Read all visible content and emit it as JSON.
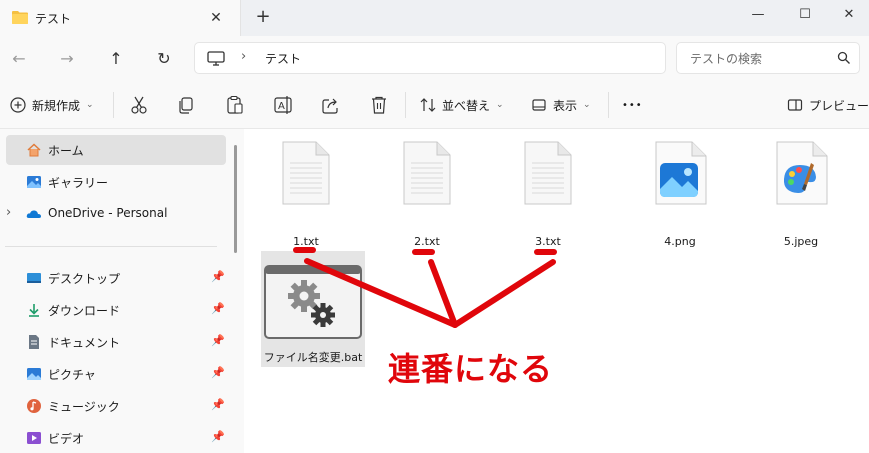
{
  "window": {
    "tab_title": "テスト",
    "close_tab_glyph": "✕",
    "new_tab_glyph": "+",
    "minimize_glyph": "—",
    "maximize_glyph": "☐",
    "close_glyph": "✕"
  },
  "address": {
    "back_glyph": "←",
    "forward_glyph": "→",
    "up_glyph": "↑",
    "refresh_glyph": "↻",
    "chevron": "›",
    "path": "テスト",
    "search_placeholder": "テストの検索"
  },
  "toolbar": {
    "new_label": "新規作成",
    "sort_label": "並べ替え",
    "view_label": "表示",
    "more_glyph": "•••",
    "preview_label": "プレビュー",
    "caret": "⌄"
  },
  "sidebar": {
    "items": [
      {
        "label": "ホーム",
        "icon": "home-icon"
      },
      {
        "label": "ギャラリー",
        "icon": "gallery-icon"
      },
      {
        "label": "OneDrive - Personal",
        "icon": "onedrive-icon"
      },
      {
        "label": "デスクトップ",
        "icon": "desktop-icon"
      },
      {
        "label": "ダウンロード",
        "icon": "download-icon"
      },
      {
        "label": "ドキュメント",
        "icon": "documents-icon"
      },
      {
        "label": "ピクチャ",
        "icon": "pictures-icon"
      },
      {
        "label": "ミュージック",
        "icon": "music-icon"
      },
      {
        "label": "ビデオ",
        "icon": "videos-icon"
      }
    ],
    "expand_glyph": "›",
    "pin_glyph": "📌"
  },
  "files": [
    {
      "name": "1.txt",
      "icon": "text-file-icon"
    },
    {
      "name": "2.txt",
      "icon": "text-file-icon"
    },
    {
      "name": "3.txt",
      "icon": "text-file-icon"
    },
    {
      "name": "4.png",
      "icon": "image-file-icon"
    },
    {
      "name": "5.jpeg",
      "icon": "paint-file-icon"
    },
    {
      "name": "ファイル名変更.bat",
      "icon": "batch-file-icon"
    }
  ],
  "annotation": {
    "text": "連番になる",
    "color": "#e0060b"
  }
}
